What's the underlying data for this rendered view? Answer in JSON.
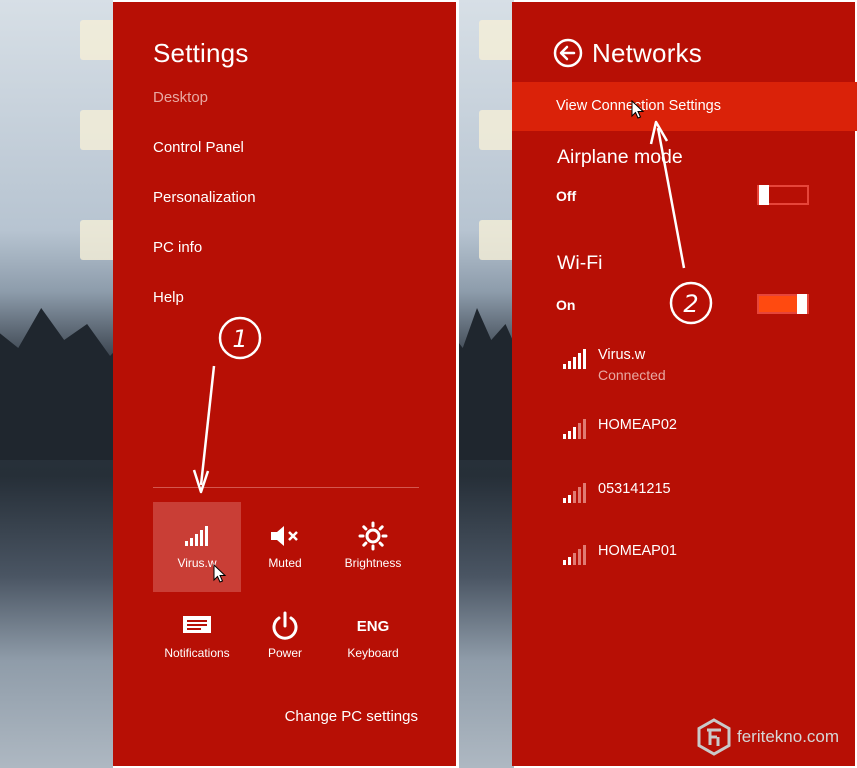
{
  "settings": {
    "title": "Settings",
    "menu": [
      "Desktop",
      "Control Panel",
      "Personalization",
      "PC info",
      "Help"
    ],
    "quick_tiles": [
      {
        "label": "Virus.w",
        "icon": "wifi-signal-icon",
        "selected": true
      },
      {
        "label": "Muted",
        "icon": "speaker-muted-icon",
        "selected": false
      },
      {
        "label": "Brightness",
        "icon": "brightness-icon",
        "selected": false
      },
      {
        "label": "Notifications",
        "icon": "notifications-icon",
        "selected": false
      },
      {
        "label": "Power",
        "icon": "power-icon",
        "selected": false
      },
      {
        "label": "Keyboard",
        "icon": "keyboard-icon",
        "glyph": "ENG",
        "selected": false
      }
    ],
    "change_pc_settings": "Change PC settings"
  },
  "networks": {
    "title": "Networks",
    "view_connection_settings": "View Connection Settings",
    "airplane": {
      "label": "Airplane mode",
      "state": "Off",
      "on": false
    },
    "wifi": {
      "label": "Wi-Fi",
      "state": "On",
      "on": true
    },
    "list": [
      {
        "name": "Virus.w",
        "status": "Connected",
        "signal": 5
      },
      {
        "name": "HOMEAP02",
        "status": "",
        "signal": 3
      },
      {
        "name": "053141215",
        "status": "",
        "signal": 2
      },
      {
        "name": "HOMEAP01",
        "status": "",
        "signal": 2
      }
    ]
  },
  "annotations": {
    "step1": "1",
    "step2": "2"
  },
  "watermark": {
    "text": "feritekno.com"
  },
  "colors": {
    "panel": "#b70f05",
    "highlight": "#da2209",
    "toggle_on": "#ff4a10"
  }
}
